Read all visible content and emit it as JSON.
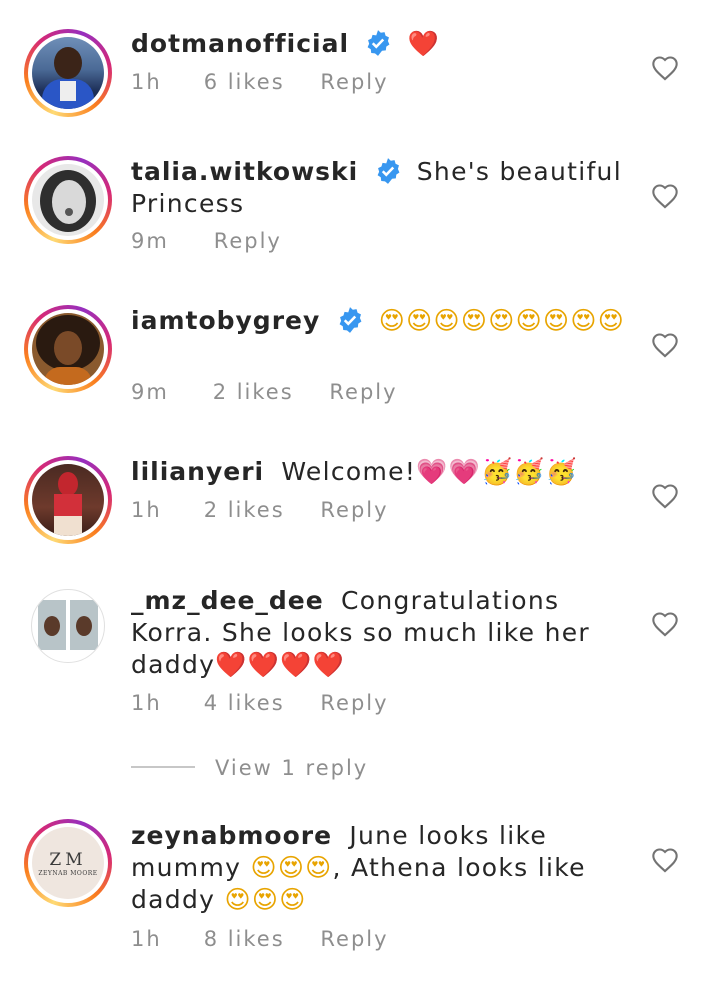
{
  "comments": [
    {
      "username": "dotmanofficial",
      "verified": true,
      "text": "",
      "emoji": "❤️",
      "time": "1h",
      "likes": "6 likes",
      "reply": "Reply"
    },
    {
      "username": "talia.witkowski",
      "verified": true,
      "text": "She's beautiful Princess",
      "time": "9m",
      "likes": "",
      "reply": "Reply"
    },
    {
      "username": "iamtobygrey",
      "verified": true,
      "text": "",
      "emoji": "😍😍😍😍😍😍😍😍😍",
      "time": "9m",
      "likes": "2 likes",
      "reply": "Reply"
    },
    {
      "username": "lilianyeri",
      "verified": false,
      "text": "Welcome!",
      "emoji": "💗💗🥳🥳🥳",
      "time": "1h",
      "likes": "2 likes",
      "reply": "Reply"
    },
    {
      "username": "_mz_dee_dee",
      "verified": false,
      "text": "Congratulations Korra. She looks so much like her daddy",
      "emoji": "❤️❤️❤️❤️",
      "time": "1h",
      "likes": "4 likes",
      "reply": "Reply",
      "view_replies": "View 1 reply"
    },
    {
      "username": "zeynabmoore",
      "verified": false,
      "text": "June looks like mummy",
      "emoji_1": "😍😍😍",
      "text_2": ", Athena looks like daddy",
      "emoji_2": "😍😍😍",
      "avatar_logo": "ZM",
      "avatar_logo_sub": "ZEYNAB MOORE",
      "time": "1h",
      "likes": "8 likes",
      "reply": "Reply"
    }
  ],
  "colors": {
    "verified_blue": "#3897f0",
    "meta_gray": "#8e8e8e",
    "text": "#262626"
  },
  "icons": {
    "like": "heart-outline-icon",
    "verified": "verified-badge-icon"
  }
}
